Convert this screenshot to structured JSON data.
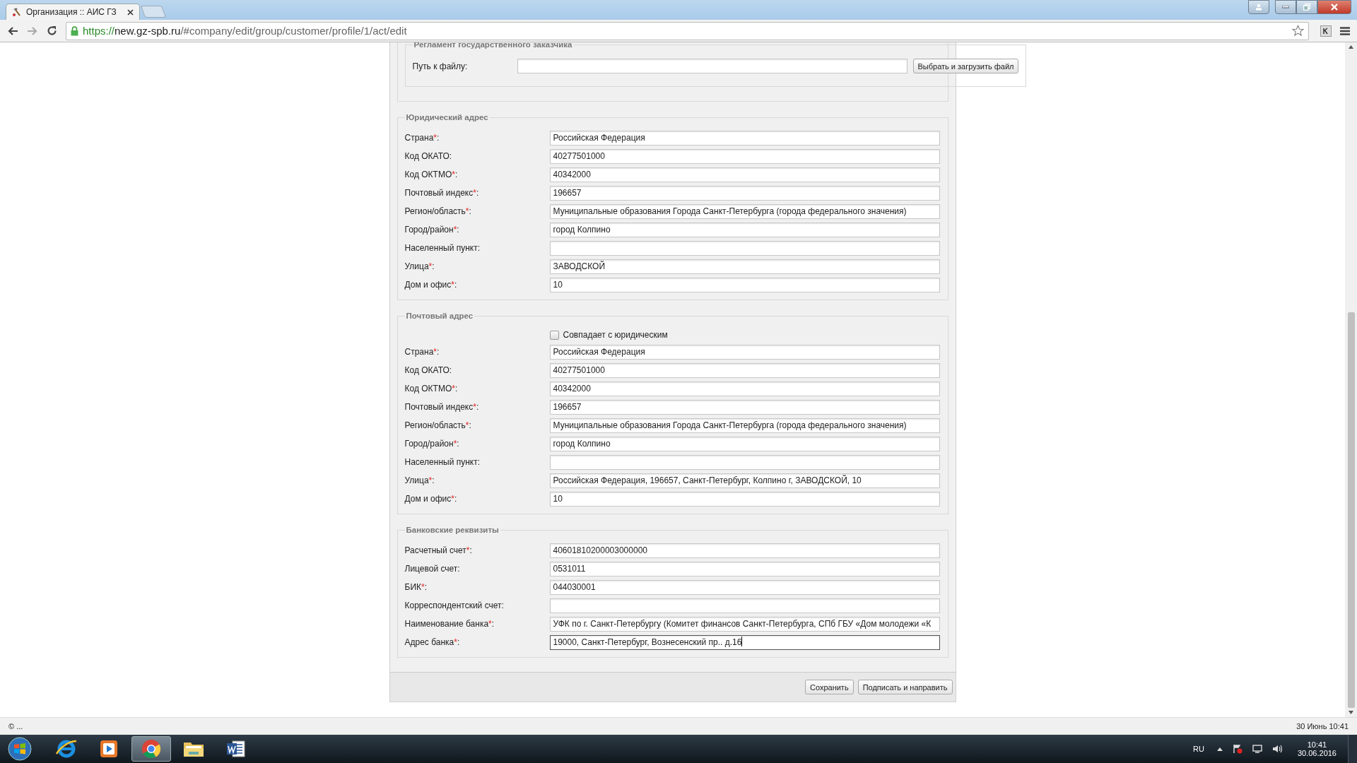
{
  "browser": {
    "tab": {
      "title": "Организация :: АИС ГЗ"
    },
    "address": {
      "scheme": "https://",
      "host": "new.gz-spb.ru",
      "path": "/#company/edit/group/customer/profile/1/act/edit"
    }
  },
  "sections": [
    {
      "kind": "file",
      "legend": "Регламент государственного заказчика",
      "label": "Путь к файлу:",
      "button": "Выбрать и загрузить файл"
    },
    {
      "kind": "fields",
      "legend": "Юридический адрес",
      "fields": [
        {
          "label": "Страна",
          "required_mark": "*",
          "suffix": ":",
          "value": "Российская Федерация"
        },
        {
          "label": "Код ОКАТО:",
          "value": "40277501000"
        },
        {
          "label": "Код ОКТМО",
          "required_mark": "*",
          "suffix": ":",
          "value": "40342000"
        },
        {
          "label": "Почтовый индекс",
          "required_mark": "*",
          "suffix": ":",
          "value": "196657"
        },
        {
          "label": "Регион/область",
          "required_mark": "*",
          "suffix": ":",
          "value": "Муниципальные образования Города Санкт-Петербурга (города федерального значения)"
        },
        {
          "label": "Город/район",
          "required_mark": "*",
          "suffix": ":",
          "value": "город Колпино"
        },
        {
          "label": "Населенный пункт:"
        },
        {
          "label": "Улица",
          "required_mark": "*",
          "suffix": ":",
          "value": "ЗАВОДСКОЙ"
        },
        {
          "label": "Дом и офис",
          "required_mark": "*",
          "suffix": ":",
          "value": "10"
        }
      ]
    },
    {
      "kind": "fields",
      "legend": "Почтовый адрес",
      "checkbox": {
        "label": "Совпадает с юридическим",
        "checked": false
      },
      "fields": [
        {
          "label": "Страна",
          "required_mark": "*",
          "suffix": ":",
          "value": "Российская Федерация"
        },
        {
          "label": "Код ОКАТО:",
          "value": "40277501000"
        },
        {
          "label": "Код ОКТМО",
          "required_mark": "*",
          "suffix": ":",
          "value": "40342000"
        },
        {
          "label": "Почтовый индекс",
          "required_mark": "*",
          "suffix": ":",
          "value": "196657"
        },
        {
          "label": "Регион/область",
          "required_mark": "*",
          "suffix": ":",
          "value": "Муниципальные образования Города Санкт-Петербурга (города федерального значения)"
        },
        {
          "label": "Город/район",
          "required_mark": "*",
          "suffix": ":",
          "value": "город Колпино"
        },
        {
          "label": "Населенный пункт:"
        },
        {
          "label": "Улица",
          "required_mark": "*",
          "suffix": ":",
          "value": "Российская Федерация, 196657, Санкт-Петербург, Колпино г, ЗАВОДСКОЙ, 10"
        },
        {
          "label": "Дом и офис",
          "required_mark": "*",
          "suffix": ":",
          "value": "10"
        }
      ]
    },
    {
      "kind": "fields",
      "legend": "Банковские реквизиты",
      "fields": [
        {
          "label": "Расчетный счет",
          "required_mark": "*",
          "suffix": ":",
          "value": "40601810200003000000",
          "focused": false
        },
        {
          "label": "Лицевой счет:",
          "value": "0531011",
          "focused": false
        },
        {
          "label": "БИК",
          "required_mark": "*",
          "suffix": ":",
          "value": "044030001",
          "focused": false
        },
        {
          "label": "Корреспондентский счет:",
          "focused": false
        },
        {
          "label": "Наименование банка",
          "required_mark": "*",
          "suffix": ":",
          "value": "УФК по г. Санкт-Петербургу (Комитет финансов Санкт-Петербурга, СПб ГБУ «Дом молодежи «К",
          "focused": false
        },
        {
          "label": "Адрес банка",
          "required_mark": "*",
          "suffix": ":",
          "value": "19000, Санкт-Петербург, Вознесенский пр.. д.16",
          "focused": true
        }
      ]
    }
  ],
  "actions": [
    "Сохранить",
    "Подписать и направить"
  ],
  "status_bar": {
    "left": "© ...",
    "right": "30 Июнь 10:41"
  },
  "taskbar": {
    "apps": [
      {
        "kind": "ie",
        "active": false
      },
      {
        "kind": "player",
        "active": false
      },
      {
        "kind": "chrome",
        "active": true
      },
      {
        "kind": "folder",
        "active": false
      },
      {
        "kind": "word",
        "active": false
      }
    ],
    "language": "RU",
    "time": "10:41",
    "date": "30.06.2016"
  }
}
